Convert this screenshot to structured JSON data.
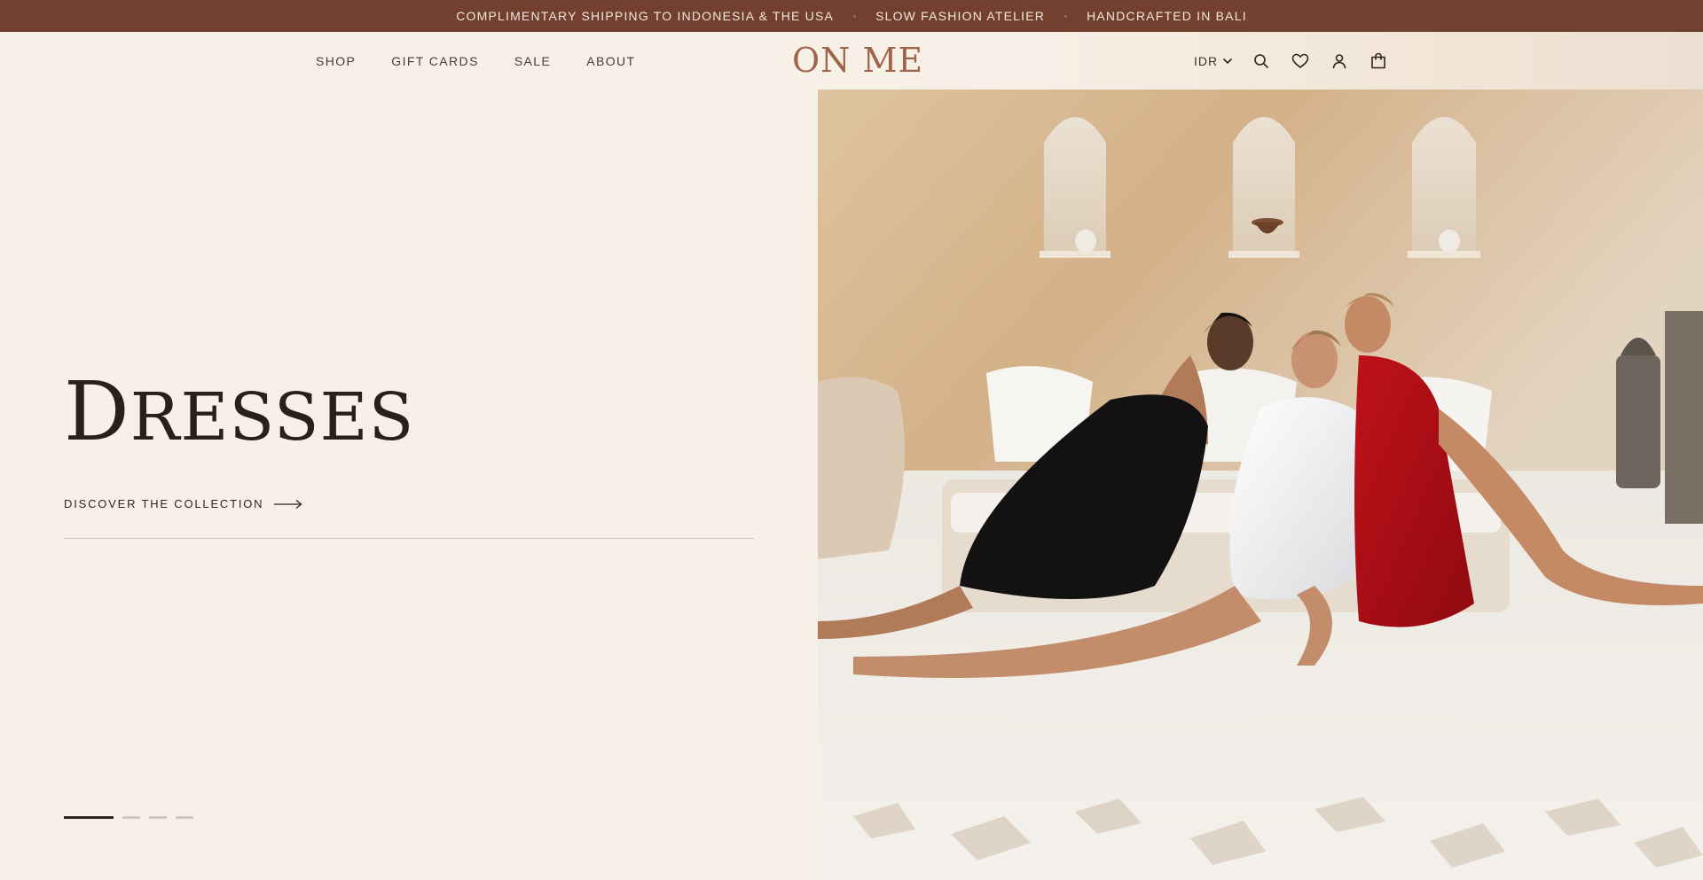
{
  "announcement": {
    "messages": [
      "COMPLIMENTARY SHIPPING TO INDONESIA & THE USA",
      "SLOW FASHION ATELIER",
      "HANDCRAFTED IN BALI"
    ]
  },
  "header": {
    "nav": [
      "SHOP",
      "GIFT CARDS",
      "SALE",
      "ABOUT"
    ],
    "logo": "ON ME",
    "currency": "IDR",
    "icons": [
      "search-icon",
      "heart-icon",
      "user-icon",
      "bag-icon"
    ]
  },
  "hero": {
    "title_first": "D",
    "title_rest": "RESSES",
    "cta": "DISCOVER THE COLLECTION",
    "slides": 4,
    "active_slide": 1
  },
  "colors": {
    "announce_bg": "#733f2f",
    "page_bg": "#f6f0e6",
    "logo": "#a0644a",
    "text": "#2a1f1a"
  }
}
